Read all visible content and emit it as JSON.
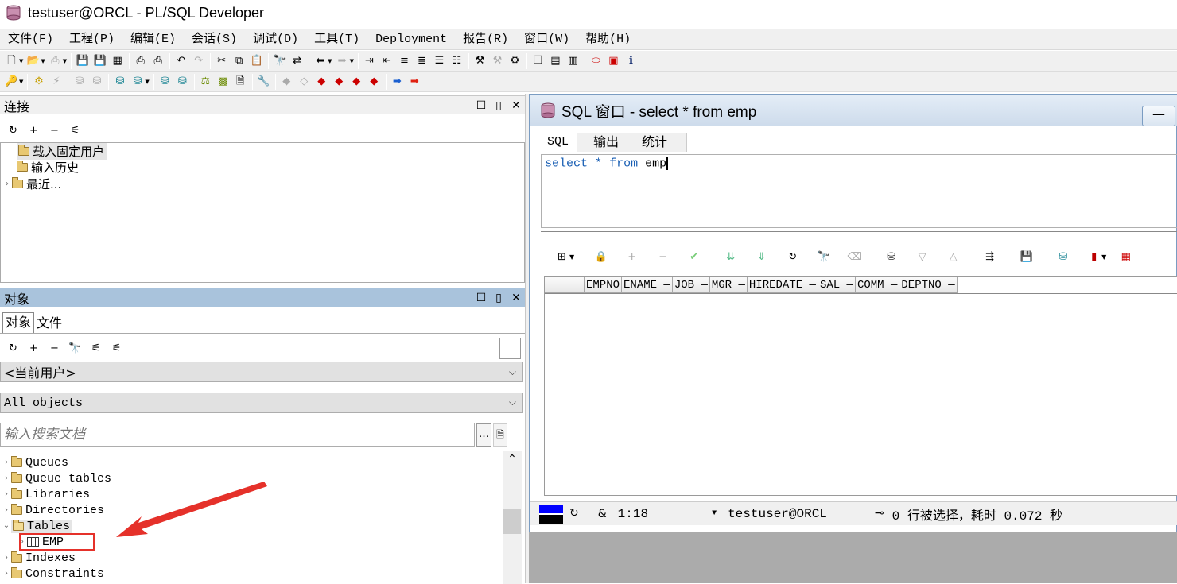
{
  "window": {
    "title": "testuser@ORCL - PL/SQL Developer"
  },
  "menu": [
    "文件(F)",
    "工程(P)",
    "编辑(E)",
    "会话(S)",
    "调试(D)",
    "工具(T)",
    "Deployment",
    "报告(R)",
    "窗口(W)",
    "帮助(H)"
  ],
  "connections_panel": {
    "title": "连接",
    "items": [
      "载入固定用户",
      "输入历史",
      "最近..."
    ]
  },
  "objects_panel": {
    "title": "对象",
    "tabs": [
      "对象",
      "文件"
    ],
    "user_select": "<当前用户>",
    "filter_select": "All objects",
    "search_placeholder": "输入搜索文档",
    "tree": [
      "Queues",
      "Queue tables",
      "Libraries",
      "Directories",
      "Tables",
      "EMP",
      "Indexes",
      "Constraints"
    ]
  },
  "sql_window": {
    "title": "SQL 窗口 - select * from emp",
    "tabs": [
      "SQL",
      "输出",
      "统计"
    ],
    "sql_kw1": "select",
    "sql_star": "*",
    "sql_kw2": "from",
    "sql_table": "emp",
    "columns": [
      "EMPNO",
      "ENAME",
      "JOB",
      "MGR",
      "HIREDATE",
      "SAL",
      "COMM",
      "DEPTNO"
    ],
    "status": {
      "position": "1:18",
      "amp": "&",
      "connection": "testuser@ORCL",
      "message": "0 行被选择，耗时 0.072 秒"
    }
  },
  "colors": {
    "highlight_box": "#e5312a",
    "arrow": "#e5312a",
    "panel_active": "#a9c3dc",
    "sql_keyword": "#1a5fb4"
  }
}
